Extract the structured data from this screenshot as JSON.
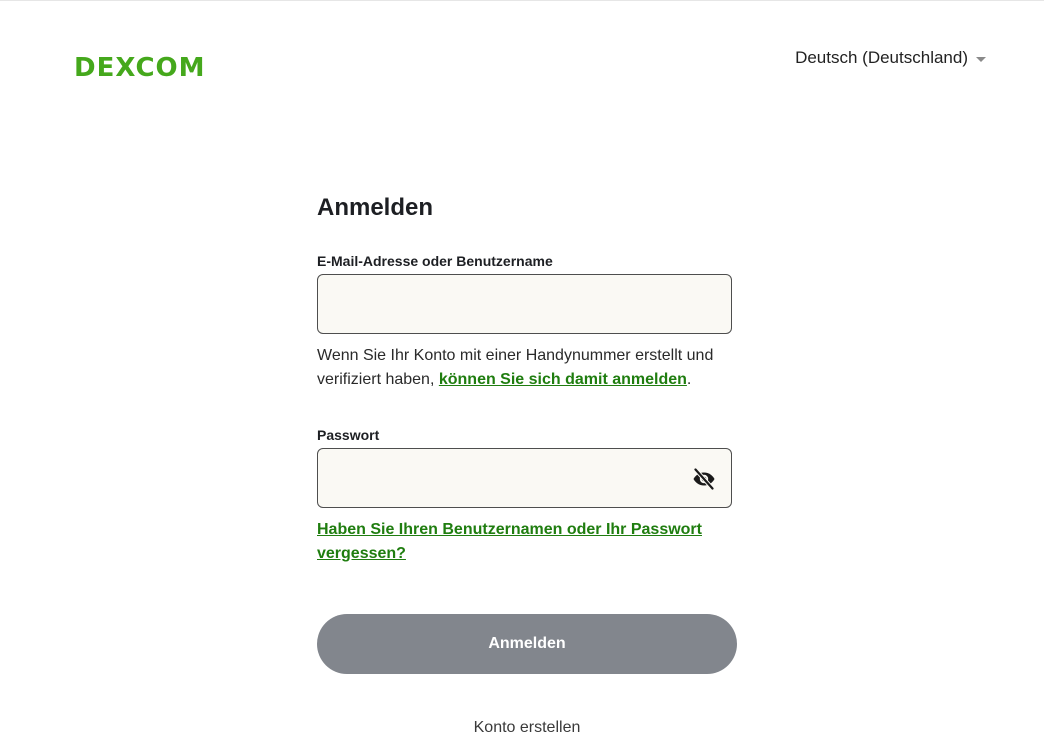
{
  "header": {
    "logo_text": "DEXCOM",
    "language": {
      "selected": "Deutsch (Deutschland)"
    }
  },
  "form": {
    "title": "Anmelden",
    "email": {
      "label": "E-Mail-Adresse oder Benutzername",
      "value": "",
      "placeholder": ""
    },
    "phone_hint": {
      "text": "Wenn Sie Ihr Konto mit einer Handynummer erstellt und verifiziert haben, ",
      "link": "können Sie sich damit anmelden",
      "suffix": "."
    },
    "password": {
      "label": "Passwort",
      "value": "",
      "placeholder": ""
    },
    "forgot_link": "Haben Sie Ihren Benutzernamen oder Ihr Passwort vergessen?",
    "submit_label": "Anmelden",
    "create_account": "Konto erstellen"
  },
  "icons": {
    "password_toggle": "eye-off-icon",
    "language_caret": "caret-down-icon"
  },
  "colors": {
    "brand_green": "#45a81c",
    "link_green": "#1f7d0f",
    "button_disabled": "#82868d",
    "input_background": "#faf9f4"
  }
}
